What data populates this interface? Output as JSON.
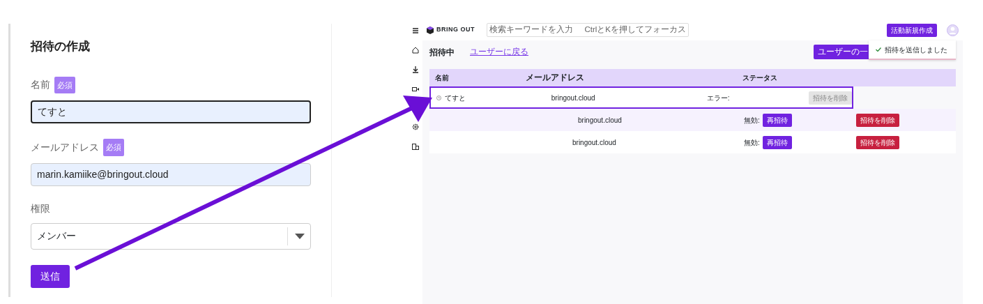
{
  "form": {
    "title": "招待の作成",
    "fields": [
      {
        "label": "名前",
        "required_badge": "必須",
        "value": "てすと",
        "focused": true
      },
      {
        "label": "メールアドレス",
        "required_badge": "必須",
        "value": "marin.kamiike@bringout.cloud",
        "focused": false
      }
    ],
    "role": {
      "label": "権限",
      "value": "メンバー"
    },
    "submit": "送信"
  },
  "app": {
    "logo": "BRING OUT",
    "search": {
      "placeholder": "検索キーワードを入力",
      "hint": "CtrlとKを押してフォーカス"
    },
    "new_button": "活動新規作成",
    "page_title": "招待中",
    "back_link": "ユーザーに戻る",
    "list_button": "ユーザーの一",
    "toast": "招待を送信しました",
    "columns": [
      "名前",
      "メールアドレス",
      "ステータス"
    ],
    "rows": [
      {
        "name": "てすと",
        "email": "bringout.cloud",
        "status": "エラー:",
        "reinvite": "",
        "delete": "招待を削除",
        "delete_disabled": true,
        "highlighted": true
      },
      {
        "name": "",
        "email": "bringout.cloud",
        "status": "無効:",
        "reinvite": "再招待",
        "delete": "招待を削除",
        "delete_disabled": false,
        "highlighted": false
      },
      {
        "name": "",
        "email": "bringout.cloud",
        "status": "無効:",
        "reinvite": "再招待",
        "delete": "招待を削除",
        "delete_disabled": false,
        "highlighted": false
      }
    ]
  }
}
